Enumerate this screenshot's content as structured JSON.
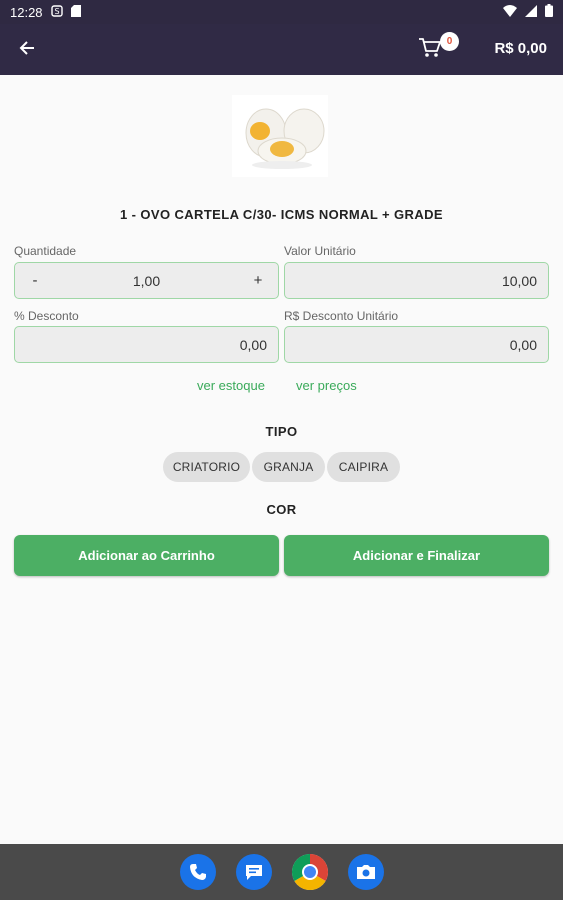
{
  "status_bar": {
    "time": "12:28",
    "icons": [
      "s-logo-icon",
      "sd-card-icon",
      "wifi-icon",
      "signal-icon",
      "battery-icon"
    ]
  },
  "app_bar": {
    "back_icon": "arrow-left-icon",
    "cart_icon": "cart-icon",
    "cart_count": "0",
    "cart_total": "R$ 0,00",
    "colors": {
      "bar": "#302a45",
      "badge_text": "#e0533b"
    }
  },
  "product": {
    "image": "eggs-image",
    "title": "1 - OVO CARTELA C/30- ICMS NORMAL + GRADE"
  },
  "fields": {
    "quantity": {
      "label": "Quantidade",
      "value": "1,00",
      "minus": "-",
      "plus": "+"
    },
    "unit_price": {
      "label": "Valor Unitário",
      "value": "10,00"
    },
    "discount_percent": {
      "label": "% Desconto",
      "value": "0,00"
    },
    "discount_unit": {
      "label": "R$ Desconto Unitário",
      "value": "0,00"
    }
  },
  "links": {
    "stock": "ver estoque",
    "prices": "ver preços"
  },
  "tipo": {
    "title": "TIPO",
    "options": [
      "CRIATORIO",
      "GRANJA",
      "CAIPIRA"
    ]
  },
  "cor": {
    "title": "COR"
  },
  "actions": {
    "add_to_cart": "Adicionar ao Carrinho",
    "add_and_finish": "Adicionar e Finalizar",
    "color": "#4caf64"
  },
  "dock": {
    "apps": [
      "phone-icon",
      "messages-icon",
      "chrome-icon",
      "camera-icon"
    ]
  }
}
